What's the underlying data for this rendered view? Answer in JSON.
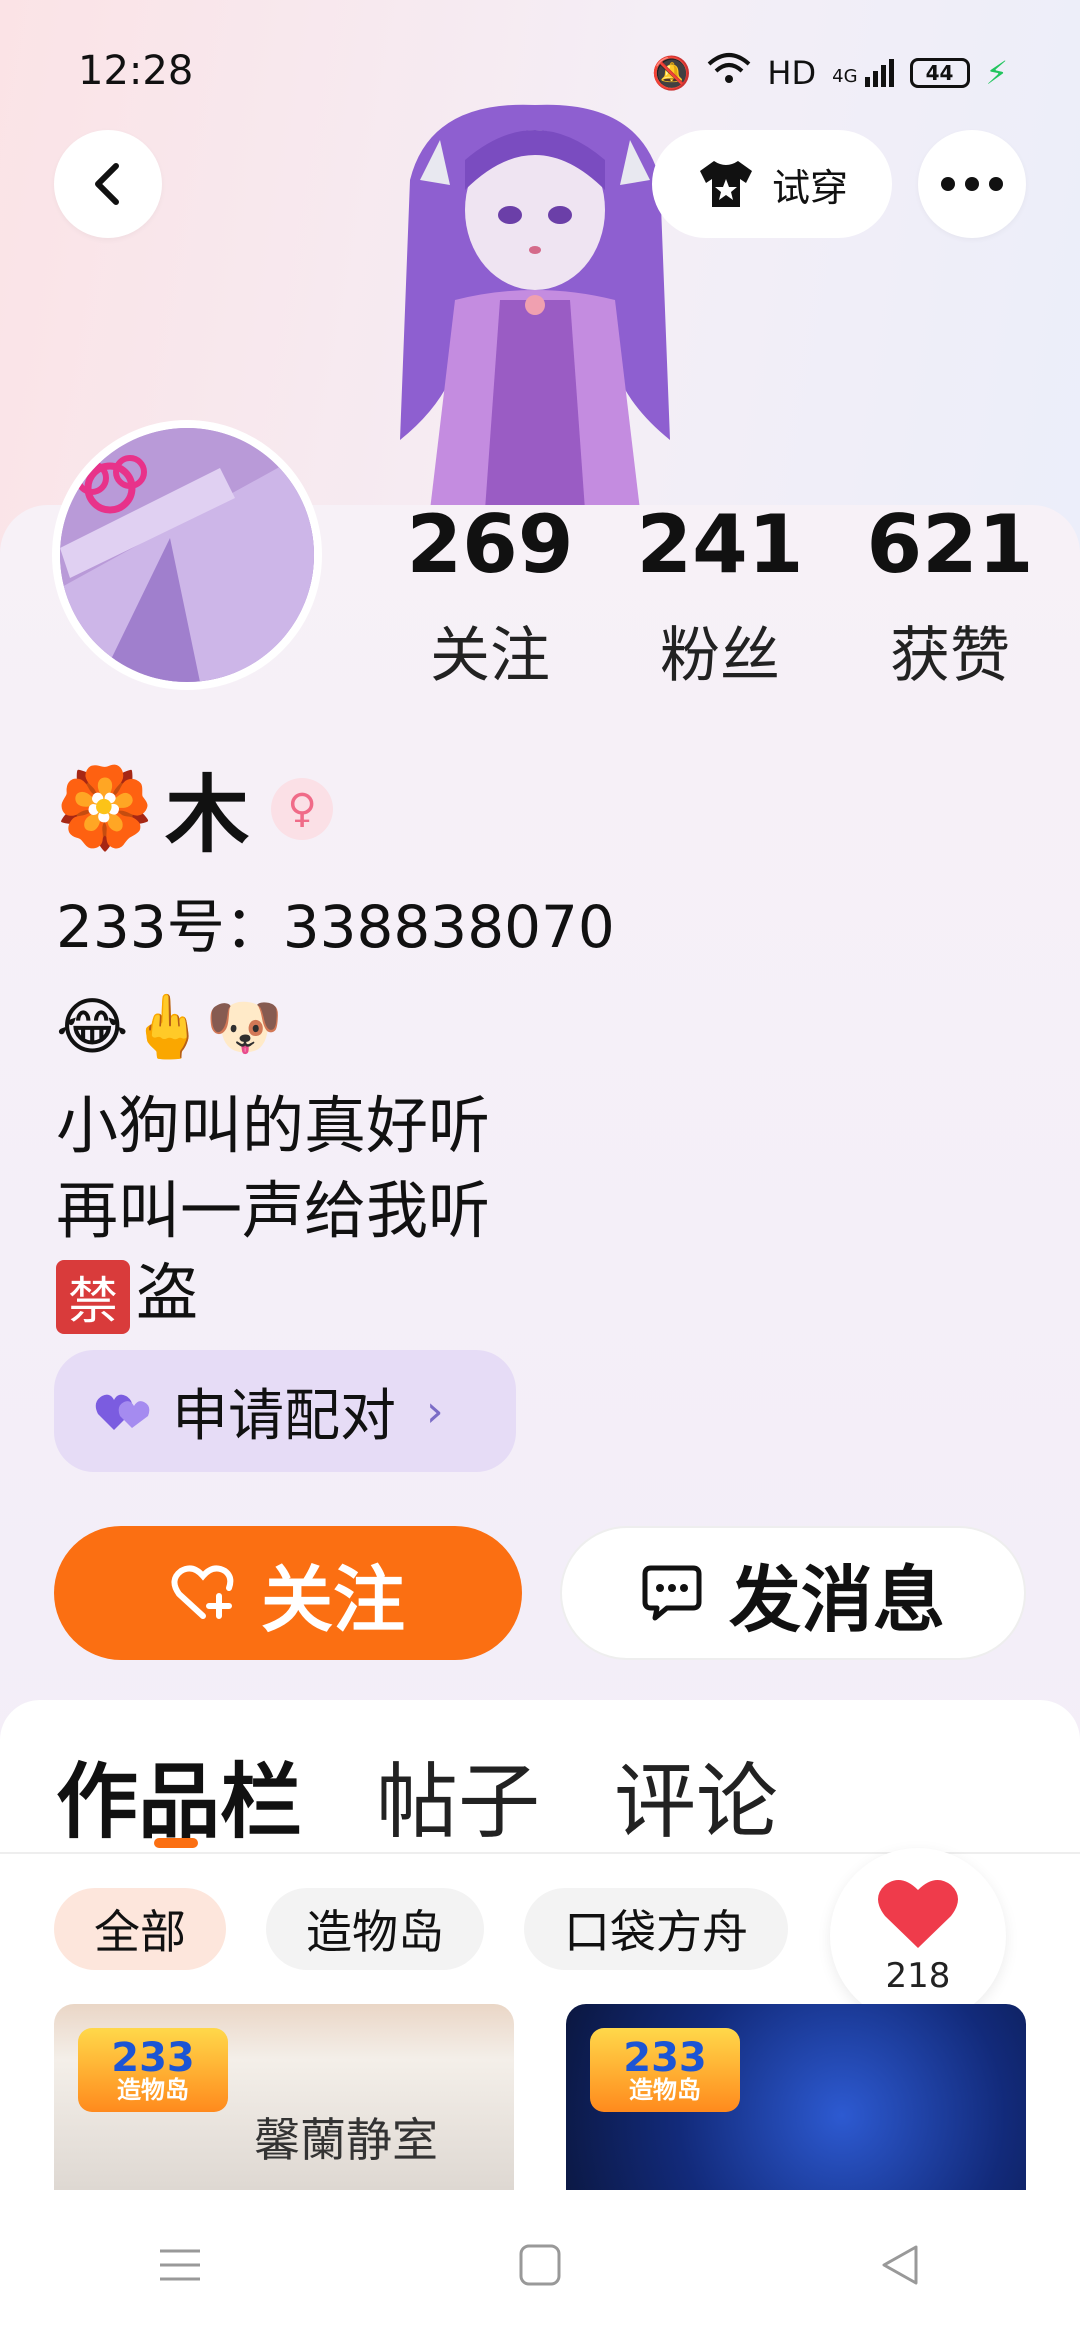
{
  "status_bar": {
    "time": "12:28",
    "network": "HD",
    "signal": "4G",
    "battery": "44"
  },
  "header": {
    "tryon_label": "试穿"
  },
  "stats": [
    {
      "value": "269",
      "label": "关注"
    },
    {
      "value": "241",
      "label": "粉丝"
    },
    {
      "value": "621",
      "label": "获赞"
    }
  ],
  "profile": {
    "name_emoji": "🏵️",
    "name": "木",
    "gender_symbol": "♀",
    "uid": "233号：338838070",
    "bio_emojis": "😂🖕🐶",
    "bio_lines": [
      "小狗叫的真好听",
      "再叫一声给我听"
    ],
    "ban_badge": "禁",
    "ban_text": "盗"
  },
  "pair_button": {
    "label": "申请配对"
  },
  "actions": {
    "follow_label": "关注",
    "message_label": "发消息"
  },
  "tabs": [
    {
      "label": "作品栏",
      "active": true
    },
    {
      "label": "帖子",
      "active": false
    },
    {
      "label": "评论",
      "active": false
    }
  ],
  "filters": [
    {
      "label": "全部",
      "active": true
    },
    {
      "label": "造物岛",
      "active": false
    },
    {
      "label": "口袋方舟",
      "active": false
    }
  ],
  "like_count": "218",
  "thumbnails": [
    {
      "badge_top": "233",
      "badge_bottom": "造物岛",
      "caption": "馨蘭静室"
    },
    {
      "badge_top": "233",
      "badge_bottom": "造物岛",
      "caption": ""
    }
  ],
  "colors": {
    "accent": "#fb6f12",
    "pair_bg": "#e6dcf6",
    "heart": "#ef3b4b"
  }
}
